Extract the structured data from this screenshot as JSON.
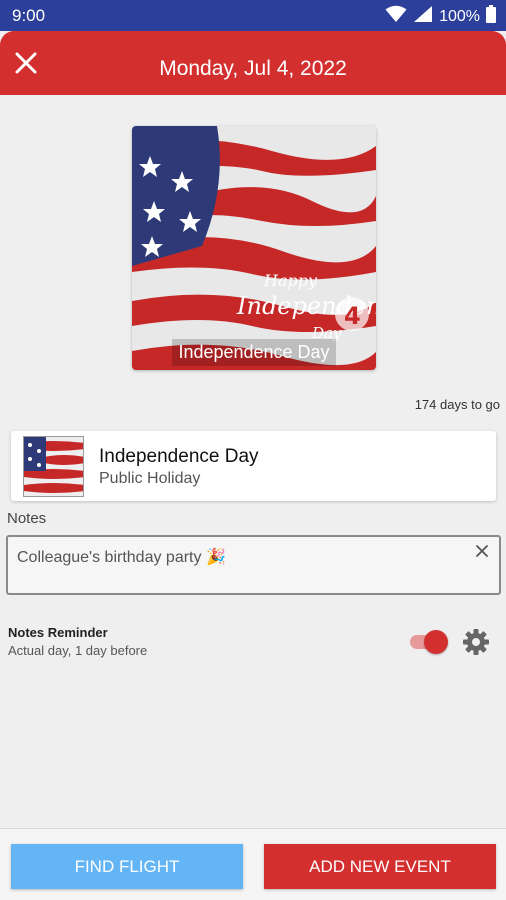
{
  "status_bar": {
    "time": "9:00",
    "battery": "100%",
    "icons": [
      "wifi-icon",
      "signal-icon",
      "battery-icon"
    ]
  },
  "header": {
    "title": "Monday, Jul 4, 2022",
    "close_icon": "close-icon",
    "color": "#d32f2f"
  },
  "hero": {
    "caption": "Independence Day",
    "art_text_1": "Happy",
    "art_text_2": "Independence",
    "art_text_3": "Day",
    "art_number": "4"
  },
  "countdown": "174 days to go",
  "event": {
    "name": "Independence Day",
    "type": "Public Holiday"
  },
  "notes": {
    "label": "Notes",
    "value": "Colleague's birthday party 🎉",
    "clear_icon": "close-icon"
  },
  "reminder": {
    "title": "Notes Reminder",
    "subtitle": "Actual day, 1 day before",
    "enabled": true,
    "settings_icon": "gear-icon"
  },
  "actions": {
    "find_flight": "FIND FLIGHT",
    "add_event": "ADD NEW EVENT"
  },
  "colors": {
    "status_bar": "#2c3f9a",
    "accent": "#d32f2f",
    "flight_button": "#64b5f6"
  }
}
